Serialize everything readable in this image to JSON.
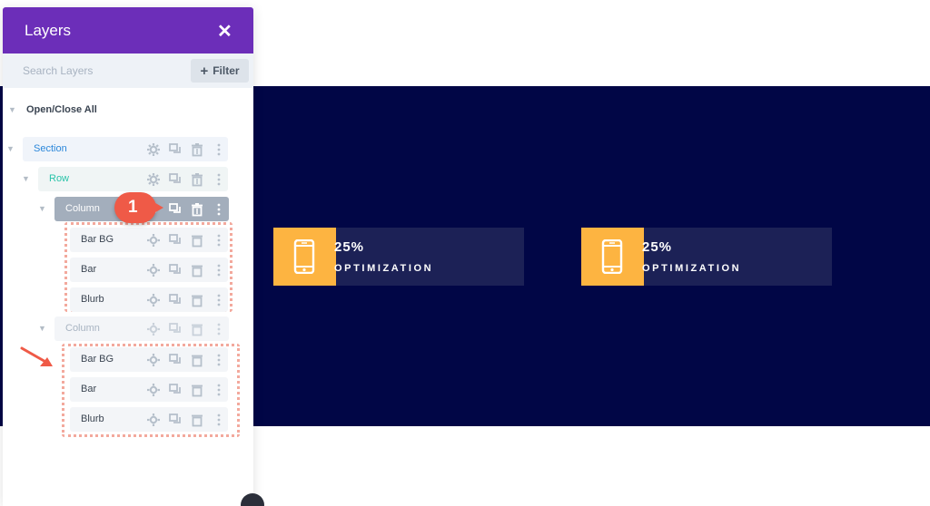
{
  "layers_panel": {
    "title": "Layers",
    "close_icon": "close-icon",
    "search": {
      "placeholder": "Search Layers",
      "value": ""
    },
    "filter": {
      "label": "Filter",
      "icon": "plus-icon"
    },
    "open_close_all": "Open/Close All",
    "tree": {
      "section": "Section",
      "row": "Row",
      "column_1": {
        "label": "Column",
        "modules": [
          "Bar BG",
          "Bar",
          "Blurb"
        ]
      },
      "column_2": {
        "label": "Column",
        "modules": [
          "Bar BG",
          "Bar",
          "Blurb"
        ]
      }
    },
    "row_tools": [
      "gear-icon",
      "duplicate-icon",
      "trash-icon",
      "more-icon"
    ],
    "callout_number": "1"
  },
  "canvas": {
    "blurbs": [
      {
        "percent": "25%",
        "label": "OPTIMIZATION",
        "icon": "smartphone-icon"
      },
      {
        "percent": "25%",
        "label": "OPTIMIZATION",
        "icon": "smartphone-icon"
      }
    ]
  },
  "colors": {
    "header_purple": "#6c2eb9",
    "section_navy": "#010646",
    "blurb_bg": "#1c2156",
    "accent_yellow": "#fdb441",
    "callout_red": "#ef5a47",
    "section_blue": "#2b87da",
    "row_green": "#29c4a9"
  }
}
